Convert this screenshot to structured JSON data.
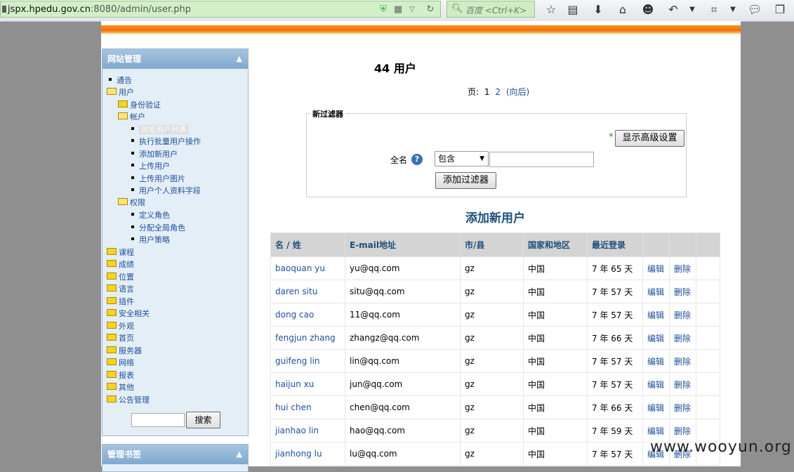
{
  "browser": {
    "url_domain": "jspx.hpedu.gov.cn",
    "url_path": ":8080/admin/user.php",
    "search_placeholder": "百度 <Ctrl+K>"
  },
  "sidebar": {
    "admin_title": "网站管理",
    "bookmarks_title": "管理书签",
    "search_button": "搜索",
    "tree": {
      "notices": "通告",
      "users": "用户",
      "auth": "身份验证",
      "accounts": "帐户",
      "browse_users": "浏览用户列表",
      "bulk_actions": "执行批量用户操作",
      "add_user": "添加新用户",
      "upload_users": "上传用户",
      "upload_pictures": "上传用户图片",
      "profile_fields": "用户个人资料字段",
      "permissions": "权限",
      "define_roles": "定义角色",
      "assign_roles": "分配全局角色",
      "user_policies": "用户策略",
      "courses": "课程",
      "grades": "成绩",
      "location": "位置",
      "language": "语言",
      "plugins": "插件",
      "security": "安全相关",
      "appearance": "外观",
      "front_page": "首页",
      "server": "服务器",
      "network": "网络",
      "reports": "报表",
      "other": "其他",
      "announcements": "公告管理"
    }
  },
  "main": {
    "title": "44 用户",
    "paging_label": "页:",
    "page_1": "1",
    "page_2": "2",
    "next": "(向后)",
    "filter_legend": "新过滤器",
    "advanced_star": "*",
    "advanced_button": "显示高级设置",
    "fullname_label": "全名",
    "help_icon": "?",
    "select_value": "包含",
    "add_filter_button": "添加过滤器",
    "add_user_heading": "添加新用户",
    "columns": [
      "名 / 姓",
      "E-mail地址",
      "市/县",
      "国家和地区",
      "最近登录"
    ],
    "edit_label": "编辑",
    "delete_label": "删除",
    "rows": [
      {
        "name": "baoquan yu",
        "email": "yu@qq.com",
        "city": "gz",
        "country": "中国",
        "last": "7 年 65 天"
      },
      {
        "name": "daren situ",
        "email": "situ@qq.com",
        "city": "gz",
        "country": "中国",
        "last": "7 年 57 天"
      },
      {
        "name": "dong cao",
        "email": "11@qq.com",
        "city": "gz",
        "country": "中国",
        "last": "7 年 57 天"
      },
      {
        "name": "fengjun zhang",
        "email": "zhangz@qq.com",
        "city": "gz",
        "country": "中国",
        "last": "7 年 66 天"
      },
      {
        "name": "guifeng lin",
        "email": "lin@qq.com",
        "city": "gz",
        "country": "中国",
        "last": "7 年 57 天"
      },
      {
        "name": "haijun xu",
        "email": "jun@qq.com",
        "city": "gz",
        "country": "中国",
        "last": "7 年 57 天"
      },
      {
        "name": "hui chen",
        "email": "chen@qq.com",
        "city": "gz",
        "country": "中国",
        "last": "7 年 66 天"
      },
      {
        "name": "jianhao lin",
        "email": "hao@qq.com",
        "city": "gz",
        "country": "中国",
        "last": "7 年 59 天"
      },
      {
        "name": "jianhong lu",
        "email": "lu@qq.com",
        "city": "gz",
        "country": "中国",
        "last": "7 年 57 天"
      }
    ]
  },
  "watermark": "www.wooyun.org"
}
